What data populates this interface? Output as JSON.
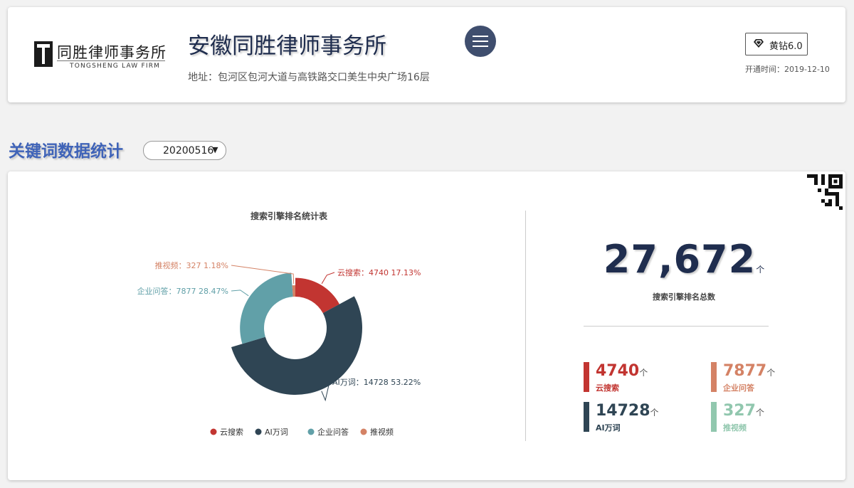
{
  "header": {
    "logo_cn": "同胜律师事务所",
    "logo_en": "TONGSHENG LAW FIRM",
    "company_name": "安徽同胜律师事务所",
    "address": "地址：包河区包河大道与高铁路交口美生中央广场16层",
    "level_label": "黄钻6.0",
    "open_date": "开通时间：2019-12-10",
    "menu_icon": "hamburger-menu-icon"
  },
  "section": {
    "title": "关键词数据统计",
    "date_value": "20200516"
  },
  "chart_data": {
    "type": "pie",
    "title": "搜索引擎排名统计表",
    "series": [
      {
        "name": "云搜索",
        "value": 4740,
        "percent": "17.13%",
        "color": "#c23531"
      },
      {
        "name": "AI万词",
        "value": 14728,
        "percent": "53.22%",
        "color": "#2f4554"
      },
      {
        "name": "企业问答",
        "value": 7877,
        "percent": "28.47%",
        "color": "#61a0a8"
      },
      {
        "name": "推视频",
        "value": 327,
        "percent": "1.18%",
        "color": "#d48265"
      }
    ],
    "legend": [
      "云搜索",
      "AI万词",
      "企业问答",
      "推视频"
    ],
    "legend_position": "bottom-center"
  },
  "summary": {
    "total_value": "27,672",
    "total_unit": "个",
    "total_label": "搜索引擎排名总数",
    "stats": [
      {
        "value": "4740",
        "unit": "个",
        "label": "云搜索",
        "color": "#c23531"
      },
      {
        "value": "7877",
        "unit": "个",
        "label": "企业问答",
        "color": "#d48265"
      },
      {
        "value": "14728",
        "unit": "个",
        "label": "AI万词",
        "color": "#2f4554"
      },
      {
        "value": "327",
        "unit": "个",
        "label": "推视频",
        "color": "#91c7ae"
      }
    ]
  }
}
